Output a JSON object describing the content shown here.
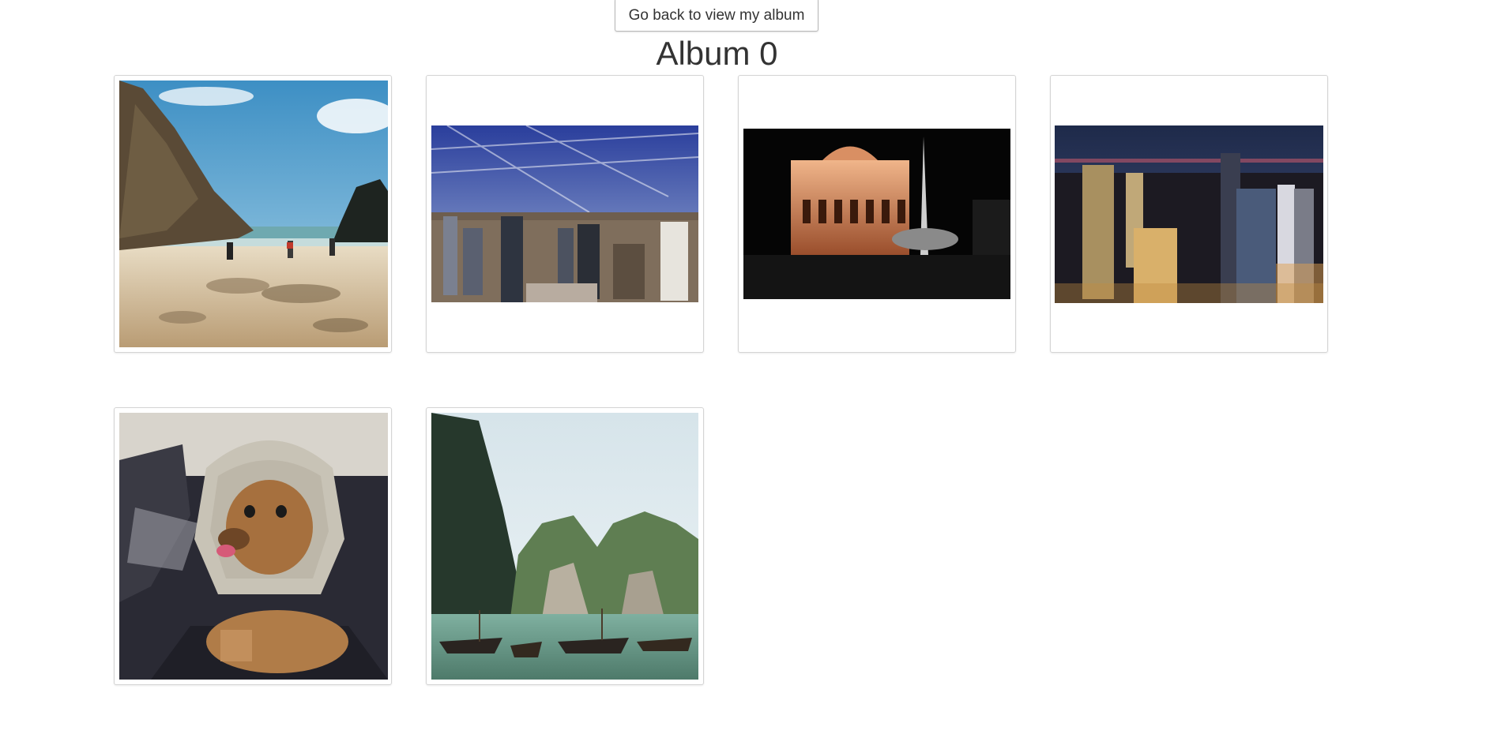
{
  "header": {
    "back_button_label": "Go back to view my album",
    "album_title": "Album 0"
  },
  "photos": [
    {
      "subject": "beach with cliffs and people walking"
    },
    {
      "subject": "city skyline aerial view with clouds"
    },
    {
      "subject": "illuminated opera house at night with fountain"
    },
    {
      "subject": "city skyscrapers at night"
    },
    {
      "subject": "dog wearing knitted hood in car"
    },
    {
      "subject": "limestone cliffs with long-tail boats"
    }
  ]
}
